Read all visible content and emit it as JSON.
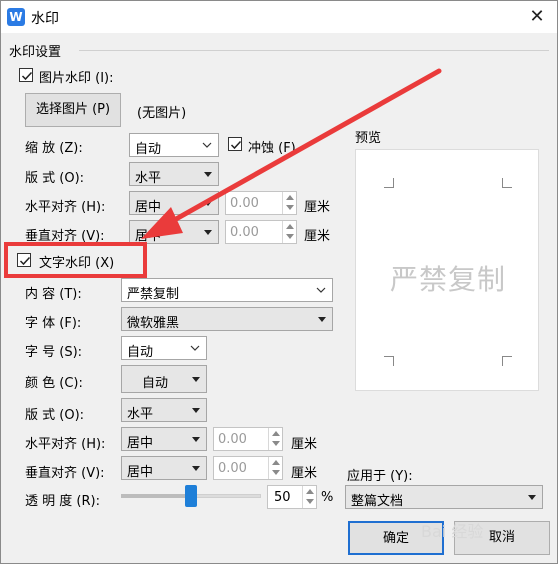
{
  "window": {
    "title": "水印",
    "logo_letter": "W",
    "close_glyph": "✕"
  },
  "group": {
    "label": "水印设置"
  },
  "picture_watermark": {
    "label": "图片水印 (I):",
    "checked": true,
    "select_button": "选择图片 (P)",
    "no_picture": "(无图片)",
    "scale_label": "缩   放 (Z):",
    "scale_value": "自动",
    "washout_label": "冲蚀 (F)",
    "washout_checked": true,
    "layout_label": "版   式 (O):",
    "layout_value": "水平",
    "halign_label": "水平对齐 (H):",
    "halign_value": "居中",
    "halign_offset": "0.00",
    "valign_label": "垂直对齐 (V):",
    "valign_value": "居中",
    "valign_offset": "0.00",
    "unit": "厘米"
  },
  "preview": {
    "label": "预览",
    "text": "严禁复制"
  },
  "text_watermark": {
    "label": "文字水印 (X)",
    "checked": true,
    "content_label": "内   容 (T):",
    "content_value": "严禁复制",
    "font_label": "字   体 (F):",
    "font_value": "微软雅黑",
    "size_label": "字   号 (S):",
    "size_value": "自动",
    "color_label": "颜   色 (C):",
    "color_value": "自动",
    "layout_label": "版   式 (O):",
    "layout_value": "水平",
    "halign_label": "水平对齐 (H):",
    "halign_value": "居中",
    "halign_offset": "0.00",
    "valign_label": "垂直对齐 (V):",
    "valign_value": "居中",
    "valign_offset": "0.00",
    "unit": "厘米",
    "transparency_label": "透 明 度 (R):",
    "transparency_value": "50",
    "transparency_unit": "%",
    "transparency_level": 0.5
  },
  "apply": {
    "label": "应用于 (Y):",
    "value": "整篇文档"
  },
  "buttons": {
    "ok": "确定",
    "cancel": "取消"
  },
  "annotation": {
    "color": "#ea3b3b"
  },
  "watermark_text": "Bai 经验"
}
